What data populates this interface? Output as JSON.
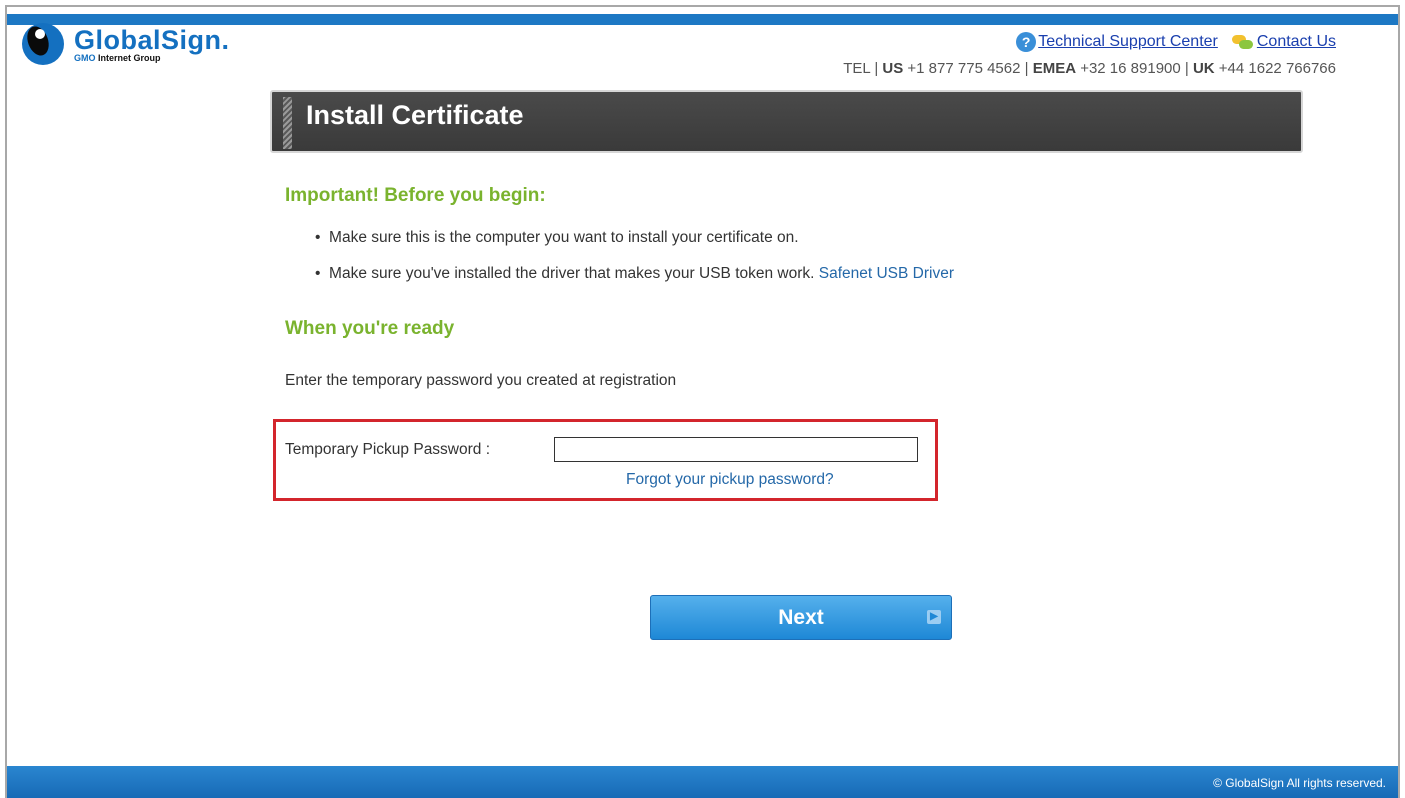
{
  "header": {
    "logo_name": "GlobalSign.",
    "logo_sub_gmo": "GMO",
    "logo_sub_rest": " Internet Group",
    "support_link": "Technical Support Center",
    "contact_link": "Contact Us",
    "tel": {
      "prefix": "TEL | ",
      "us_label": "US",
      "us_number": " +1 877 775 4562 | ",
      "emea_label": "EMEA",
      "emea_number": " +32 16 891900 | ",
      "uk_label": "UK",
      "uk_number": " +44 1622 766766"
    }
  },
  "page_title": "Install Certificate",
  "important": {
    "heading": "Important! Before you begin:",
    "bullets": [
      "Make sure this is the computer you want to install your certificate on.",
      "Make sure you've installed the driver that makes your USB token work. "
    ],
    "driver_link": "Safenet USB Driver"
  },
  "ready": {
    "heading": "When you're ready",
    "intro": "Enter the temporary password you created at registration"
  },
  "password": {
    "label": "Temporary Pickup Password :",
    "value": "",
    "forgot_link": "Forgot your pickup password?"
  },
  "next_button": "Next",
  "footer": "© GlobalSign All rights reserved.",
  "colors": {
    "brand_blue": "#1d78c4",
    "heading_green": "#7ab32e",
    "highlight_red": "#d3252c",
    "link_blue": "#2468a8"
  }
}
